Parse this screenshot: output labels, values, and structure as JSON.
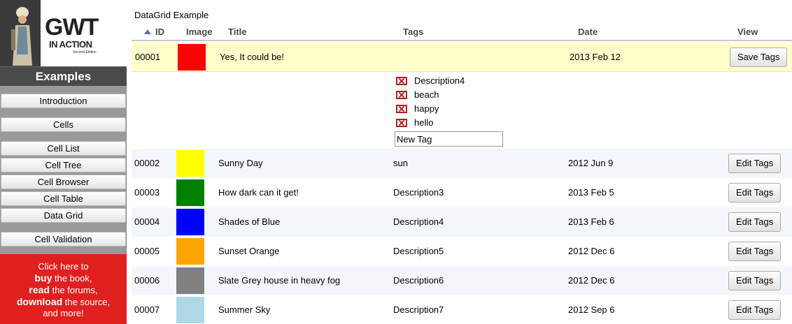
{
  "sidebar": {
    "logo": {
      "title": "GWT",
      "subtitle": "IN ACTION",
      "edition": "Second Edition"
    },
    "heading": "Examples",
    "nav": [
      {
        "label": "Introduction"
      },
      {
        "label": "Cells"
      },
      {
        "label": "Cell List"
      },
      {
        "label": "Cell Tree"
      },
      {
        "label": "Cell Browser"
      },
      {
        "label": "Cell Table"
      },
      {
        "label": "Data Grid"
      },
      {
        "label": "Cell Validation"
      }
    ],
    "promo": {
      "line1": "Click here to",
      "buy": "buy",
      "line2": " the book,",
      "read": "read",
      "line3": " the forums,",
      "download": "download",
      "line4": " the source,",
      "line5": "and more!",
      "color": "#e0201e"
    }
  },
  "grid": {
    "title": "DataGrid Example",
    "columns": {
      "id": "ID",
      "image": "Image",
      "title": "Title",
      "tags": "Tags",
      "date": "Date",
      "view": "View"
    },
    "sort": "ascending-id",
    "rows": [
      {
        "id": "00001",
        "color": "#ff0000",
        "title": "Yes, It could be!",
        "tags": "",
        "date": "2013 Feb 12",
        "button": "Save Tags"
      },
      {
        "id": "00002",
        "color": "#ffff00",
        "title": "Sunny Day",
        "tags": "sun",
        "date": "2012 Jun 9",
        "button": "Edit Tags"
      },
      {
        "id": "00003",
        "color": "#008000",
        "title": "How dark can it get!",
        "tags": "Description3",
        "date": "2013 Feb 5",
        "button": "Edit Tags"
      },
      {
        "id": "00004",
        "color": "#0000ff",
        "title": "Shades of Blue",
        "tags": "Description4",
        "date": "2013 Feb 6",
        "button": "Edit Tags"
      },
      {
        "id": "00005",
        "color": "#ffa500",
        "title": "Sunset Orange",
        "tags": "Description5",
        "date": "2012 Dec 6",
        "button": "Edit Tags"
      },
      {
        "id": "00006",
        "color": "#808080",
        "title": "Slate Grey house in heavy fog",
        "tags": "Description6",
        "date": "2012 Dec 6",
        "button": "Edit Tags"
      },
      {
        "id": "00007",
        "color": "#add8e6",
        "title": "Summer Sky",
        "tags": "Description7",
        "date": "2012 Sep 6",
        "button": "Edit Tags"
      }
    ],
    "tag_editor": {
      "tags": [
        "Description4",
        "beach",
        "happy",
        "hello"
      ],
      "new_tag_value": "New Tag",
      "remove_icon": "remove-x-icon"
    }
  }
}
